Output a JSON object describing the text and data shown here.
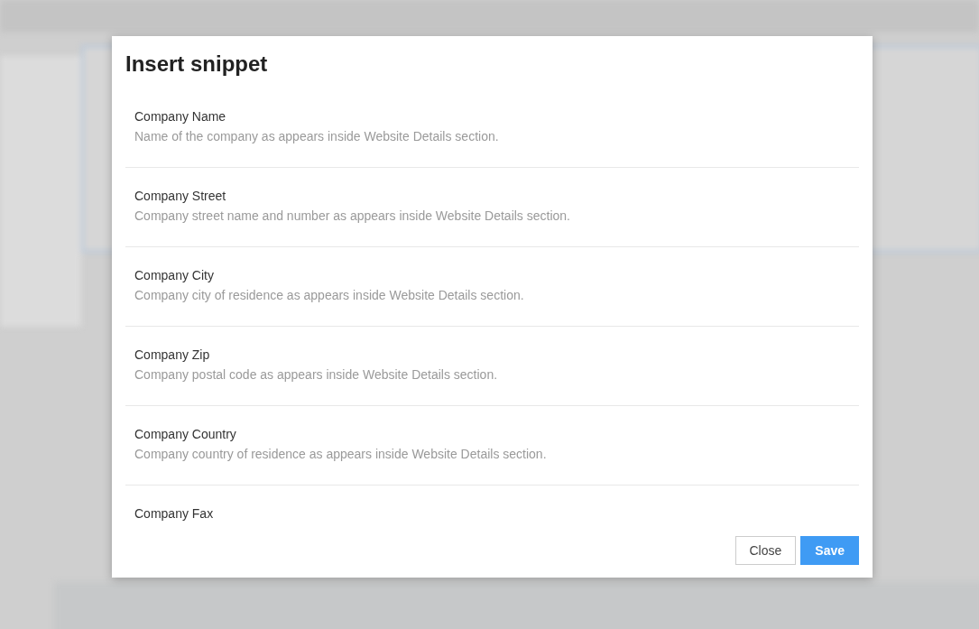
{
  "dialog": {
    "title": "Insert snippet",
    "snippets": [
      {
        "name": "Company Name",
        "description": "Name of the company as appears inside Website Details section."
      },
      {
        "name": "Company Street",
        "description": "Company street name and number as appears inside Website Details section."
      },
      {
        "name": "Company City",
        "description": "Company city of residence as appears inside Website Details section."
      },
      {
        "name": "Company Zip",
        "description": "Company postal code as appears inside Website Details section."
      },
      {
        "name": "Company Country",
        "description": "Company country of residence as appears inside Website Details section."
      },
      {
        "name": "Company Fax"
      }
    ],
    "buttons": [
      {
        "label": "Close",
        "kind": "secondary"
      },
      {
        "label": "Save",
        "kind": "primary"
      }
    ]
  }
}
